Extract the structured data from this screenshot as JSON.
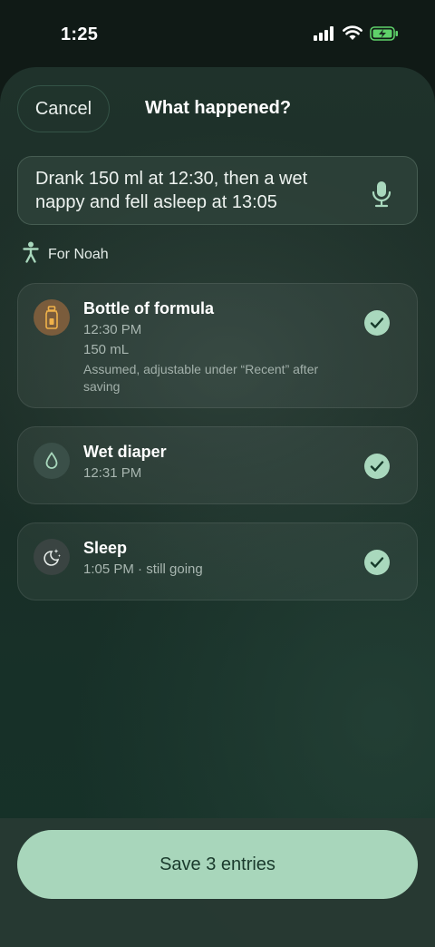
{
  "status_bar": {
    "time": "1:25"
  },
  "header": {
    "cancel_label": "Cancel",
    "title": "What happened?"
  },
  "input": {
    "text": "Drank 150 ml at 12:30, then a wet nappy and fell asleep at 13:05",
    "icon": "microphone-icon"
  },
  "child": {
    "label": "For Noah",
    "icon": "person-icon"
  },
  "entries": [
    {
      "title": "Bottle of formula",
      "time": "12:30 PM",
      "amount": "150 mL",
      "note": "Assumed, adjustable under “Recent” after saving",
      "icon": "bottle-icon"
    },
    {
      "title": "Wet diaper",
      "time": "12:31 PM",
      "icon": "droplet-icon"
    },
    {
      "title": "Sleep",
      "time": "1:05 PM · still going",
      "icon": "moon-stars-icon"
    }
  ],
  "footer": {
    "save_label": "Save 3 entries"
  },
  "colors": {
    "accent": "#a8d6bb",
    "check": "#a9d8bd",
    "bottle_icon_bg": "#7a5c3c",
    "icon_bg": "#3a4f48"
  }
}
